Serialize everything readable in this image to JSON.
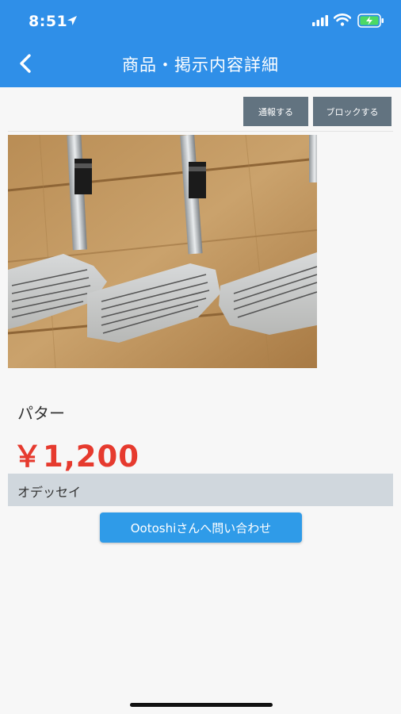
{
  "status_bar": {
    "time": "8:51",
    "location_icon": "location-arrow-icon",
    "signal_icon": "cellular-signal-icon",
    "wifi_icon": "wifi-icon",
    "battery_icon": "battery-charging-icon"
  },
  "header": {
    "back_icon": "chevron-left-icon",
    "title": "商品・掲示内容詳細",
    "background_color": "#2f8fe8"
  },
  "actions": {
    "report_label": "通報する",
    "block_label": "ブロックする",
    "button_color": "#627380"
  },
  "product": {
    "image_description_icon": "golf-iron-clubs-photo",
    "name": "パター",
    "price": "￥1,200",
    "price_color": "#e63a2e",
    "maker": "オデッセイ"
  },
  "contact": {
    "label": "Ootoshiさんへ問い合わせ",
    "button_color": "#2f9be8"
  }
}
